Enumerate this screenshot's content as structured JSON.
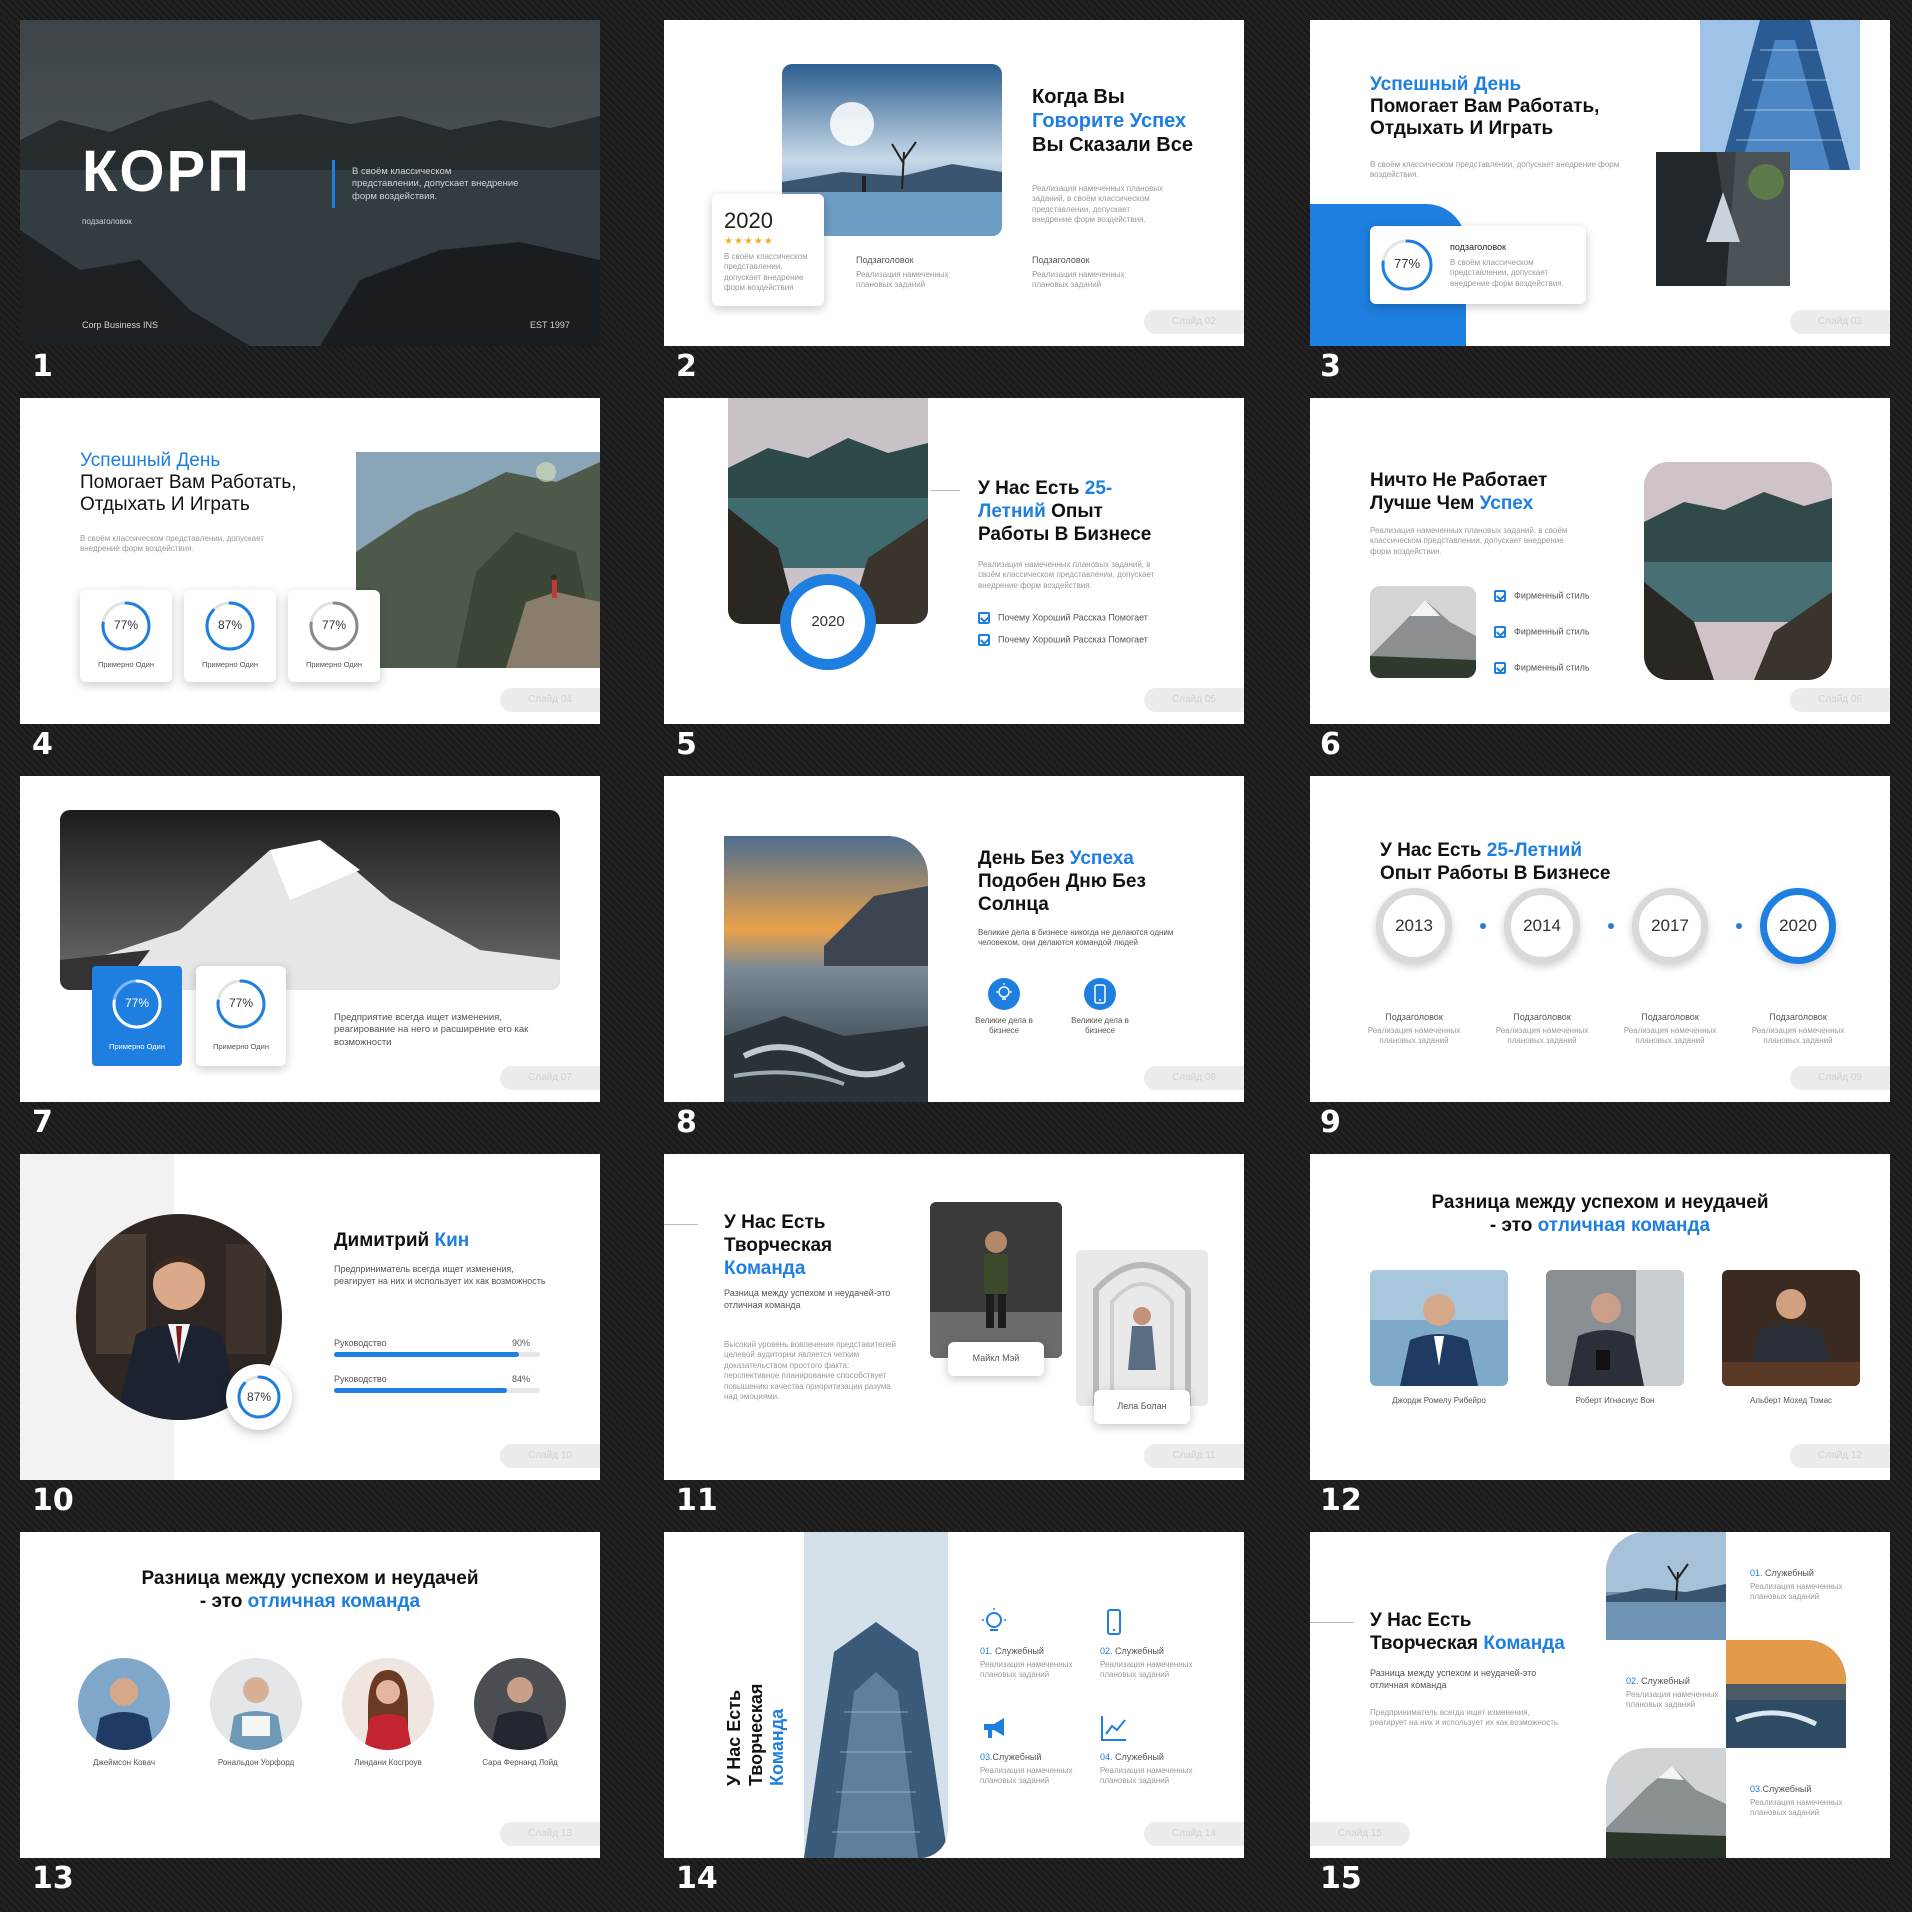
{
  "slide_numbers": [
    "1",
    "2",
    "3",
    "4",
    "5",
    "6",
    "7",
    "8",
    "9",
    "10",
    "11",
    "12",
    "13",
    "14",
    "15"
  ],
  "s1": {
    "title": "КОРП",
    "desc": "В своём классическом представлении, допускает внедрение форм воздействия.",
    "sub": "подзаголовок",
    "company": "Corp Business INS",
    "est": "EST 1997"
  },
  "s2": {
    "title1": "Когда Вы",
    "title2": "Говорите Успех",
    "title3": "Вы Сказали Все",
    "desc": "Реализация намеченных плановых заданий, в своём классическом представлении, допускает внедрение форм воздействия.",
    "year": "2020",
    "stars": "★★★★★",
    "card_text": "В своём классическом представлении, допускает внедрение форм воздействия",
    "sub1": "Подзаголовок",
    "sub1_text": "Реализация намеченных плановых заданий",
    "sub2": "Подзаголовок",
    "sub2_text": "Реализация намеченных плановых заданий",
    "pill": "Слайд 02"
  },
  "s3": {
    "title1": "Успешный День",
    "title2": "Помогает Вам Работать,",
    "title3": "Отдыхать И Играть",
    "desc": "В своём классическом представлении, допускает внедрение форм воздействия.",
    "pct": "77%",
    "card_title": "подзаголовок",
    "card_text": "В своём классическом представлении, допускает внедрение форм воздействия.",
    "pill": "Слайд 03"
  },
  "s4": {
    "title1": "Успешный День",
    "title2": "Помогает Вам Работать,",
    "title3": "Отдыхать И Играть",
    "desc": "В своём классическом представлении, допускает внедрение форм воздействия.",
    "cards": [
      {
        "pct": "77%",
        "label": "Примерно Один",
        "value": 0.77
      },
      {
        "pct": "87%",
        "label": "Примерно Один",
        "value": 0.87
      },
      {
        "pct": "77%",
        "label": "Примерно Один",
        "value": 0.77
      }
    ],
    "pill": "Слайд 04"
  },
  "s5": {
    "title1": "У Нас Есть ",
    "title1b": "25-",
    "title2a": "Летний",
    "title2b": " Опыт",
    "title3": "Работы В Бизнесе",
    "desc": "Реализация намеченных плановых заданий, в своём классическом представлении, допускает внедрение форм воздействия.",
    "year": "2020",
    "checks": [
      "Почему Хороший Рассказ Помогает",
      "Почему Хороший Рассказ Помогает"
    ],
    "pill": "Слайд 05"
  },
  "s6": {
    "title1": "Ничто Не Работает",
    "title2a": "Лучше Чем ",
    "title2b": "Успех",
    "desc": "Реализация намеченных плановых заданий, в своём классическом представлении, допускает внедрение форм воздействия.",
    "checks": [
      "Фирменный стиль",
      "Фирменный стиль",
      "Фирменный стиль"
    ],
    "pill": "Слайд 06"
  },
  "s7": {
    "pct1": "77%",
    "label1": "Примерно Один",
    "pct2": "77%",
    "label2": "Примерно Один",
    "text": "Предприятие всегда ищет изменения, реагирование на него и расширение его как возможности",
    "pill": "Слайд 07"
  },
  "s8": {
    "title1a": "День Без ",
    "title1b": "Успеха",
    "title2": "Подобен Дню Без",
    "title3": "Солнца",
    "desc": "Великие дела в бизнесе никогда не делаются одним человеком, они делаются командой людей",
    "icon1_label": "Великие дела в бизнесе",
    "icon2_label": "Великие дела в бизнесе",
    "pill": "Слайд 08"
  },
  "s9": {
    "title1a": "У Нас Есть ",
    "title1b": "25-Летний",
    "title2": "Опыт Работы В Бизнесе",
    "years": [
      {
        "year": "2013",
        "sub": "Подзаголовок",
        "text": "Реализация намеченных плановых заданий"
      },
      {
        "year": "2014",
        "sub": "Подзаголовок",
        "text": "Реализация намеченных плановых заданий"
      },
      {
        "year": "2017",
        "sub": "Подзаголовок",
        "text": "Реализация намеченных плановых заданий"
      },
      {
        "year": "2020",
        "sub": "Подзаголовок",
        "text": "Реализация намеченных плановых заданий"
      }
    ],
    "pill": "Слайд 09"
  },
  "s10": {
    "name1": "Димитрий ",
    "name2": "Кин",
    "desc": "Предприниматель всегда ищет изменения, реагирует на них и использует их как возможность",
    "pct": "87%",
    "bars": [
      {
        "label": "Руководство",
        "pct": "90%",
        "value": 0.9
      },
      {
        "label": "Руководство",
        "pct": "84%",
        "value": 0.84
      }
    ],
    "pill": "Слайд 10"
  },
  "s11": {
    "title1": "У Нас Есть",
    "title2": "Творческая",
    "title3": "Команда",
    "desc": "Разница между успехом и неудачей-это отличная команда",
    "desc2": "Высокий уровень вовлечения представителей целевой аудитории является четким доказательством простого факта: перспективное планирование способствует повышению качества приоритизации разума над эмоциями.",
    "person1": "Майкл Мэй",
    "person2": "Лела Болан",
    "pill": "Слайд 11"
  },
  "s12": {
    "title1": "Разница между успехом и неудачей",
    "title2a": "- это ",
    "title2b": "отличная команда",
    "people": [
      "Джордж Ромелу Рибейро",
      "Роберт Игнасиус Вон",
      "Альберт Мохед Томас"
    ],
    "pill": "Слайд 12"
  },
  "s13": {
    "title1": "Разница между успехом и неудачей",
    "title2a": "- это ",
    "title2b": "отличная команда",
    "people": [
      "Джеймсон Ковач",
      "Рональдон Уорфорд",
      "Линдани Косгроув",
      "Сара Фернанд Лойд"
    ],
    "pill": "Слайд 13"
  },
  "s14": {
    "vtitle1": "У Нас Есть",
    "vtitle2": "Творческая",
    "vtitle3": "Команда",
    "items": [
      {
        "num": "01.",
        "label": "Служебный",
        "text": "Реализация намеченных плановых заданий",
        "icon": "lightbulb-icon"
      },
      {
        "num": "02.",
        "label": "Служебный",
        "text": "Реализация намеченных плановых заданий",
        "icon": "phone-icon"
      },
      {
        "num": "03.",
        "label": "Служебный",
        "text": "Реализация намеченных плановых заданий",
        "icon": "megaphone-icon"
      },
      {
        "num": "04.",
        "label": "Служебный",
        "text": "Реализация намеченных плановых заданий",
        "icon": "chart-icon"
      }
    ],
    "pill": "Слайд 14"
  },
  "s15": {
    "title1": "У Нас Есть",
    "title2a": "Творческая ",
    "title2b": "Команда",
    "desc": "Разница между успехом и неудачей-это отличная команда",
    "desc2": "Предприниматель всегда ищет изменения, реагирует на них и использует их как возможность",
    "items": [
      {
        "num": "01.",
        "label": "Служебный",
        "text": "Реализация намеченных плановых заданий"
      },
      {
        "num": "02.",
        "label": "Служебный",
        "text": "Реализация намеченных плановых заданий"
      },
      {
        "num": "03.",
        "label": "Служебный",
        "text": "Реализация намеченных плановых заданий"
      }
    ],
    "pill": "Слайд 15"
  },
  "colors": {
    "accent": "#1e7fe0",
    "background": "#1e1e1e"
  }
}
